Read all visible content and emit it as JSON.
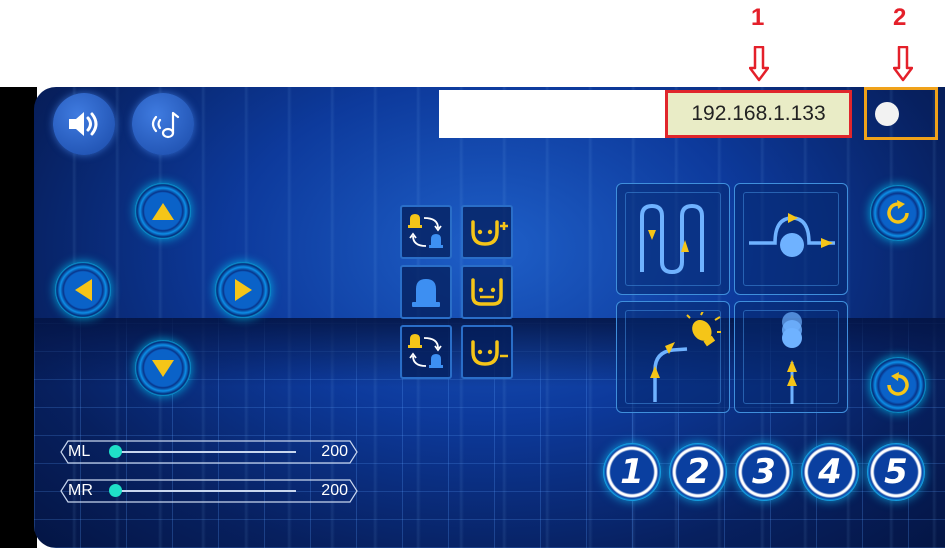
{
  "annotations": {
    "label_1": "1",
    "label_2": "2"
  },
  "connection": {
    "ip_address": "192.168.1.133"
  },
  "sliders": [
    {
      "label": "ML",
      "value": "200"
    },
    {
      "label": "MR",
      "value": "200"
    }
  ],
  "number_buttons": [
    "1",
    "2",
    "3",
    "4",
    "5"
  ],
  "icons": {
    "sound": "speaker-icon",
    "music": "music-note-icon",
    "forward": "arrow-up-icon",
    "left": "arrow-left-icon",
    "right": "arrow-right-icon",
    "backward": "arrow-down-icon",
    "rotate_cw": "rotate-clockwise-icon",
    "rotate_ccw": "rotate-counterclockwise-icon"
  },
  "colors": {
    "annotation_red": "#e4202a",
    "annotation_orange": "#f0a21a",
    "accent_yellow": "#f5c518",
    "accent_cyan": "#1fe0c8"
  }
}
